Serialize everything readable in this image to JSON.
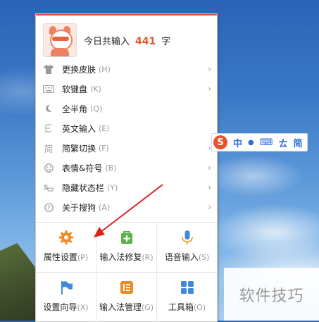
{
  "header": {
    "prefix": "今日共输入",
    "count": "441",
    "suffix": "字"
  },
  "menu_items": [
    {
      "icon": "shirt-icon",
      "label": "更换皮肤",
      "key": "(H)",
      "submenu": true
    },
    {
      "icon": "keyboard-icon",
      "label": "软键盘",
      "key": "(K)",
      "submenu": true
    },
    {
      "icon": "moon-icon",
      "label": "全半角",
      "key": "(Q)",
      "submenu": false
    },
    {
      "icon": "english-e-icon",
      "label": "英文输入",
      "key": "(E)",
      "submenu": false
    },
    {
      "icon": "jian-char-icon",
      "label": "简繁切换",
      "key": "(F)",
      "submenu": true
    },
    {
      "icon": "smiley-icon",
      "label": "表情&符号",
      "key": "(B)",
      "submenu": true
    },
    {
      "icon": "hide-statusbar-icon",
      "label": "隐藏状态栏",
      "key": "(Y)",
      "submenu": true
    },
    {
      "icon": "help-icon",
      "label": "关于搜狗",
      "key": "(A)",
      "submenu": true
    }
  ],
  "grid": [
    {
      "icon": "gear-icon",
      "label": "属性设置",
      "key": "(P)",
      "color": "#f08a24"
    },
    {
      "icon": "repair-bag-icon",
      "label": "输入法修复",
      "key": "(R)",
      "color": "#5db14a"
    },
    {
      "icon": "microphone-icon",
      "label": "语音输入",
      "key": "(S)",
      "color": "#3f8ad8"
    },
    {
      "icon": "flag-icon",
      "label": "设置向导",
      "key": "(X)",
      "color": "#3f8ad8"
    },
    {
      "icon": "manager-icon",
      "label": "输入法管理",
      "key": "(G)",
      "color": "#f08a24"
    },
    {
      "icon": "toolbox-icon",
      "label": "工具箱",
      "key": "(O)",
      "color": "#3f8ad8"
    }
  ],
  "ime_bar": {
    "logo": "S",
    "mode": "中",
    "punct": "●",
    "keyboard": "⌨",
    "tool": "ㄊ",
    "simplified": "简"
  },
  "watermark": "软件技巧",
  "colors": {
    "accent": "#e2572b",
    "ime_blue": "#2c6fd6",
    "arrow_red": "#d9221c"
  }
}
